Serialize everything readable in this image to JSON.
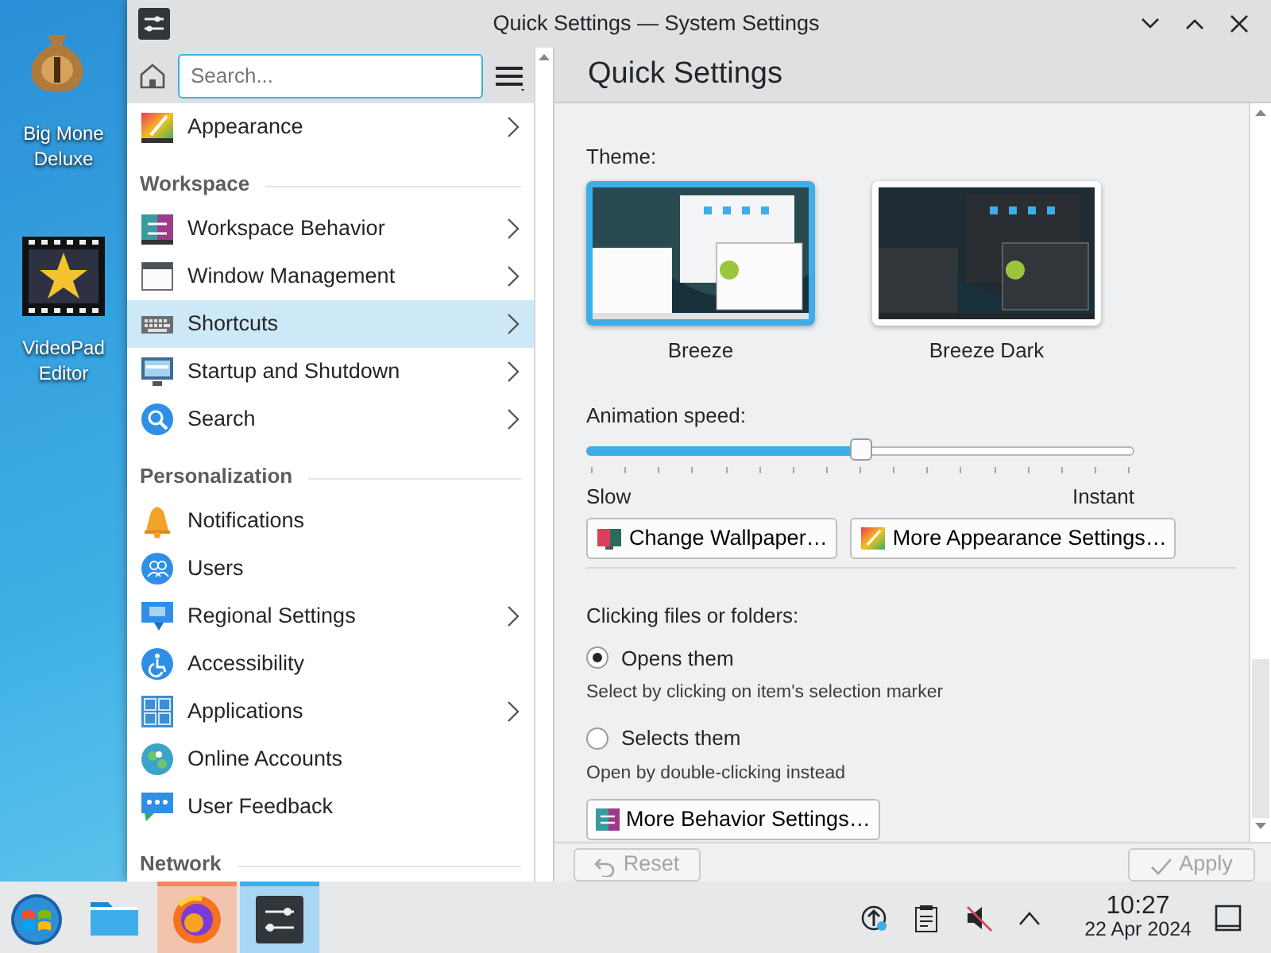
{
  "desktop_icons": [
    {
      "label_lines": [
        "Big Mone",
        "Deluxe"
      ]
    },
    {
      "label_lines": [
        "VideoPad",
        "Editor"
      ]
    }
  ],
  "window": {
    "title": "Quick Settings — System Settings"
  },
  "sidebar": {
    "search": {
      "placeholder": "Search..."
    },
    "sections": [
      {
        "items": [
          {
            "label": "Appearance",
            "expandable": true,
            "selected": false
          }
        ]
      },
      {
        "heading": "Workspace",
        "items": [
          {
            "label": "Workspace Behavior",
            "expandable": true,
            "selected": false
          },
          {
            "label": "Window Management",
            "expandable": true,
            "selected": false
          },
          {
            "label": "Shortcuts",
            "expandable": true,
            "selected": true
          },
          {
            "label": "Startup and Shutdown",
            "expandable": true,
            "selected": false
          },
          {
            "label": "Search",
            "expandable": true,
            "selected": false
          }
        ]
      },
      {
        "heading": "Personalization",
        "items": [
          {
            "label": "Notifications",
            "expandable": false,
            "selected": false
          },
          {
            "label": "Users",
            "expandable": false,
            "selected": false
          },
          {
            "label": "Regional Settings",
            "expandable": true,
            "selected": false
          },
          {
            "label": "Accessibility",
            "expandable": false,
            "selected": false
          },
          {
            "label": "Applications",
            "expandable": true,
            "selected": false
          },
          {
            "label": "Online Accounts",
            "expandable": false,
            "selected": false
          },
          {
            "label": "User Feedback",
            "expandable": false,
            "selected": false
          }
        ]
      },
      {
        "heading": "Network"
      }
    ]
  },
  "page": {
    "title": "Quick Settings",
    "theme_label": "Theme:",
    "themes": [
      {
        "name": "Breeze",
        "selected": true,
        "kind": "light"
      },
      {
        "name": "Breeze Dark",
        "selected": false,
        "kind": "dark"
      }
    ],
    "animation": {
      "label": "Animation speed:",
      "level": 0.5,
      "min_label": "Slow",
      "max_label": "Instant"
    },
    "appearance_buttons": [
      "Change Wallpaper…",
      "More Appearance Settings…"
    ],
    "clicking": {
      "label": "Clicking files or folders:",
      "options": [
        {
          "label": "Opens them",
          "description": "Select by clicking on item's selection marker",
          "selected": true
        },
        {
          "label": "Selects them",
          "description": "Open by double-clicking instead",
          "selected": false
        }
      ]
    },
    "behavior_button": "More Behavior Settings…",
    "footer_buttons": [
      {
        "label": "Reset",
        "kind": "reset",
        "disabled": true
      },
      {
        "label": "Apply",
        "kind": "apply",
        "disabled": true
      }
    ]
  },
  "taskbar": {
    "tasks": [
      {
        "kind": "files",
        "attention": false,
        "selected": false
      },
      {
        "kind": "browser",
        "attention": true,
        "selected": false
      },
      {
        "kind": "settings",
        "attention": false,
        "selected": true
      }
    ],
    "time": "10:27",
    "date": "22 Apr 2024"
  }
}
